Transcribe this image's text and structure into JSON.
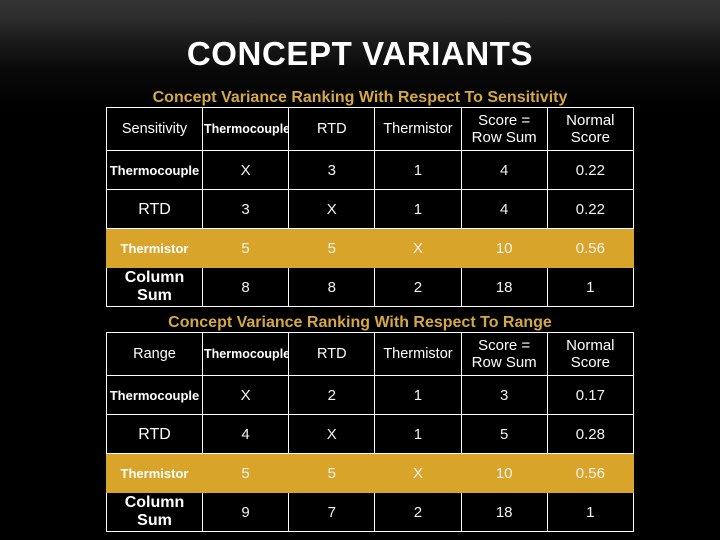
{
  "slide": {
    "title": "CONCEPT VARIANTS",
    "background_top_color": "#343434",
    "background_bottom_color": "#000000",
    "subtitle_color": "#d4a843",
    "highlight_color": "#d9a42a"
  },
  "tables": [
    {
      "id": "sensitivity",
      "subtitle": "Concept Variance Ranking With Respect To Sensitivity",
      "headers": [
        "Sensitivity",
        "Thermocouple",
        "RTD",
        "Thermistor",
        "Score = Row Sum",
        "Normal Score"
      ],
      "rows": [
        {
          "label": "Thermocouple",
          "highlight": false,
          "cells": [
            "X",
            "3",
            "1",
            "4",
            "0.22"
          ]
        },
        {
          "label": "RTD",
          "highlight": false,
          "cells": [
            "3",
            "X",
            "1",
            "4",
            "0.22"
          ]
        },
        {
          "label": "Thermistor",
          "highlight": true,
          "cells": [
            "5",
            "5",
            "X",
            "10",
            "0.56"
          ]
        },
        {
          "label": "Column Sum",
          "highlight": false,
          "cells": [
            "8",
            "8",
            "2",
            "18",
            "1"
          ]
        }
      ]
    },
    {
      "id": "range",
      "subtitle": "Concept Variance Ranking With Respect To Range",
      "headers": [
        "Range",
        "Thermocouple",
        "RTD",
        "Thermistor",
        "Score = Row Sum",
        "Normal Score"
      ],
      "rows": [
        {
          "label": "Thermocouple",
          "highlight": false,
          "cells": [
            "X",
            "2",
            "1",
            "3",
            "0.17"
          ]
        },
        {
          "label": "RTD",
          "highlight": false,
          "cells": [
            "4",
            "X",
            "1",
            "5",
            "0.28"
          ]
        },
        {
          "label": "Thermistor",
          "highlight": true,
          "cells": [
            "5",
            "5",
            "X",
            "10",
            "0.56"
          ]
        },
        {
          "label": "Column Sum",
          "highlight": false,
          "cells": [
            "9",
            "7",
            "2",
            "18",
            "1"
          ]
        }
      ]
    }
  ]
}
